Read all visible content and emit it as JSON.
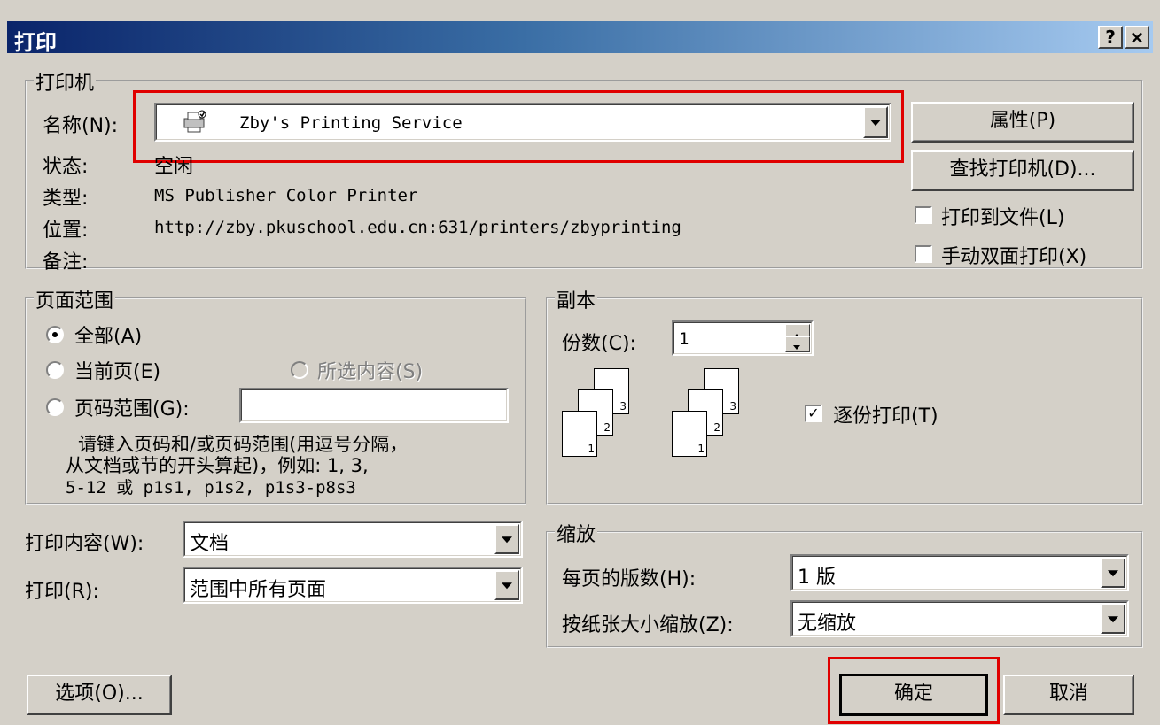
{
  "window": {
    "title": "打印",
    "help_btn": "?",
    "close_btn": "×"
  },
  "printer": {
    "group_label": "打印机",
    "name_label": "名称(N):",
    "name_value": "Zby's Printing Service",
    "status_label": "状态:",
    "status_value": "空闲",
    "type_label": "类型:",
    "type_value": "MS Publisher Color Printer",
    "location_label": "位置:",
    "location_value": "http://zby.pkuschool.edu.cn:631/printers/zbyprinting",
    "comment_label": "备注:",
    "properties_btn": "属性(P)",
    "find_btn": "查找打印机(D)...",
    "print_to_file": "打印到文件(L)",
    "manual_duplex": "手动双面打印(X)"
  },
  "range": {
    "group_label": "页面范围",
    "all": "全部(A)",
    "current": "当前页(E)",
    "selection": "所选内容(S)",
    "pages": "页码范围(G):",
    "pages_value": "",
    "hint1": "请键入页码和/或页码范围(用逗号分隔，",
    "hint2": "从文档或节的开头算起)，例如: 1, 3,",
    "hint3": "5-12 或 p1s1, p1s2, p1s3-p8s3"
  },
  "copies": {
    "group_label": "副本",
    "count_label": "份数(C):",
    "count_value": "1",
    "collate": "逐份打印(T)",
    "page_nums": [
      "1",
      "2",
      "3"
    ]
  },
  "print_what": {
    "label": "打印内容(W):",
    "value": "文档"
  },
  "print": {
    "label": "打印(R):",
    "value": "范围中所有页面"
  },
  "zoom": {
    "group_label": "缩放",
    "pages_per_sheet_label": "每页的版数(H):",
    "pages_per_sheet_value": "1 版",
    "scale_label": "按纸张大小缩放(Z):",
    "scale_value": "无缩放"
  },
  "footer": {
    "options_btn": "选项(O)...",
    "ok_btn": "确定",
    "cancel_btn": "取消"
  },
  "colors": {
    "highlight": "#e00000",
    "titlebar_start": "#0a246a",
    "titlebar_end": "#a6caf0",
    "face": "#d4d0c8"
  }
}
